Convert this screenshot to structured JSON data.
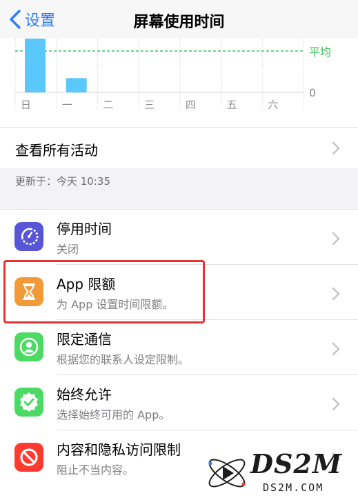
{
  "nav": {
    "back_label": "设置",
    "title": "屏幕使用时间"
  },
  "chart_data": {
    "type": "bar",
    "categories": [
      "日",
      "一",
      "二",
      "三",
      "四",
      "五",
      "六"
    ],
    "values": [
      60,
      16,
      0,
      0,
      0,
      0,
      0
    ],
    "average_label": "平均",
    "zero_label": "0",
    "colors": {
      "bar": "#5ac8fa",
      "average": "#34c759"
    }
  },
  "see_all": {
    "label": "查看所有活动"
  },
  "updated": {
    "text": "更新于：今天 10:35"
  },
  "items": [
    {
      "title": "停用时间",
      "subtitle": "关闭",
      "icon": "downtime-icon",
      "color": "#5856d6"
    },
    {
      "title": "App 限额",
      "subtitle": "为 App 设置时间限额。",
      "icon": "hourglass-icon",
      "color": "#f29a38"
    },
    {
      "title": "限定通信",
      "subtitle": "根据您的联系人设定限制。",
      "icon": "contact-icon",
      "color": "#4cd964"
    },
    {
      "title": "始终允许",
      "subtitle": "选择始终可用的 App。",
      "icon": "checkmark-badge-icon",
      "color": "#4cd964"
    },
    {
      "title": "内容和隐私访问限制",
      "subtitle": "阻止不当内容。",
      "icon": "restriction-icon",
      "color": "#ff3b30"
    }
  ],
  "watermark": {
    "name": "DS2M",
    "url": "DS2M.COM"
  }
}
